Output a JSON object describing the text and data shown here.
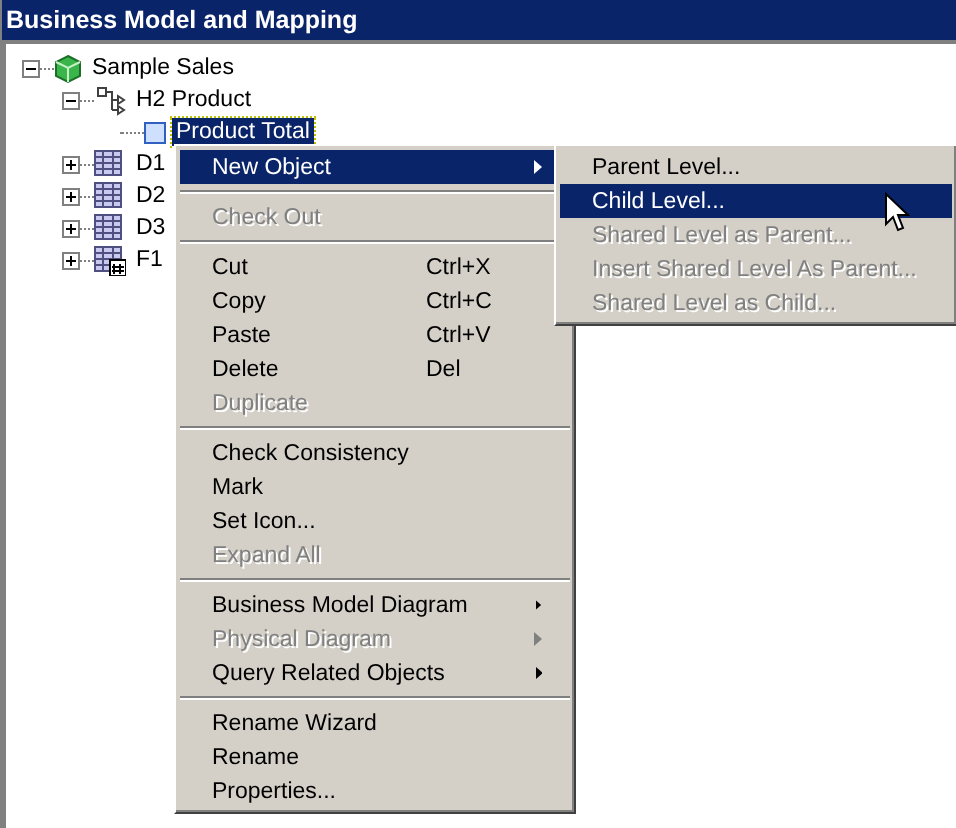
{
  "window": {
    "title": "Business Model and Mapping"
  },
  "tree": [
    {
      "label": "Sample Sales",
      "kind": "model",
      "expanded": true,
      "selected": false,
      "children": [
        {
          "label": "H2 Product",
          "kind": "hierarchy",
          "expanded": true,
          "selected": false,
          "children": [
            {
              "label": "Product Total",
              "kind": "level",
              "selected": true
            }
          ]
        },
        {
          "label": "D1",
          "kind": "table",
          "expanded": false,
          "selected": false
        },
        {
          "label": "D2",
          "kind": "table",
          "expanded": false,
          "selected": false
        },
        {
          "label": "D3",
          "kind": "table",
          "expanded": false,
          "selected": false
        },
        {
          "label": "F1",
          "kind": "fact",
          "expanded": false,
          "selected": false
        }
      ]
    }
  ],
  "context_menu": [
    {
      "kind": "item",
      "label": "New Object",
      "disabled": false,
      "submenu": true,
      "selected": true
    },
    {
      "kind": "separator"
    },
    {
      "kind": "item",
      "label": "Check Out",
      "disabled": true,
      "submenu": false,
      "selected": false
    },
    {
      "kind": "separator"
    },
    {
      "kind": "item",
      "label": "Cut",
      "shortcut": "Ctrl+X",
      "disabled": false,
      "submenu": false,
      "selected": false
    },
    {
      "kind": "item",
      "label": "Copy",
      "shortcut": "Ctrl+C",
      "disabled": false,
      "submenu": false,
      "selected": false
    },
    {
      "kind": "item",
      "label": "Paste",
      "shortcut": "Ctrl+V",
      "disabled": false,
      "submenu": false,
      "selected": false
    },
    {
      "kind": "item",
      "label": "Delete",
      "shortcut": "Del",
      "disabled": false,
      "submenu": false,
      "selected": false
    },
    {
      "kind": "item",
      "label": "Duplicate",
      "disabled": true,
      "submenu": false,
      "selected": false
    },
    {
      "kind": "separator"
    },
    {
      "kind": "item",
      "label": "Check Consistency",
      "disabled": false,
      "submenu": false,
      "selected": false
    },
    {
      "kind": "item",
      "label": "Mark",
      "disabled": false,
      "submenu": false,
      "selected": false
    },
    {
      "kind": "item",
      "label": "Set Icon...",
      "disabled": false,
      "submenu": false,
      "selected": false
    },
    {
      "kind": "item",
      "label": "Expand All",
      "disabled": true,
      "submenu": false,
      "selected": false
    },
    {
      "kind": "separator"
    },
    {
      "kind": "item",
      "label": "Business Model Diagram",
      "disabled": false,
      "submenu": true,
      "selected": false
    },
    {
      "kind": "item",
      "label": "Physical Diagram",
      "disabled": true,
      "submenu": true,
      "selected": false
    },
    {
      "kind": "item",
      "label": "Query Related Objects",
      "disabled": false,
      "submenu": true,
      "selected": false
    },
    {
      "kind": "separator"
    },
    {
      "kind": "item",
      "label": "Rename Wizard",
      "disabled": false,
      "submenu": false,
      "selected": false
    },
    {
      "kind": "item",
      "label": "Rename",
      "disabled": false,
      "submenu": false,
      "selected": false
    },
    {
      "kind": "item",
      "label": "Properties...",
      "disabled": false,
      "submenu": false,
      "selected": false
    }
  ],
  "submenu": [
    {
      "kind": "item",
      "label": "Parent Level...",
      "disabled": false,
      "selected": false
    },
    {
      "kind": "item",
      "label": "Child Level...",
      "disabled": false,
      "selected": true
    },
    {
      "kind": "item",
      "label": "Shared Level as Parent...",
      "disabled": true,
      "selected": false
    },
    {
      "kind": "item",
      "label": "Insert Shared Level As Parent...",
      "disabled": true,
      "selected": false
    },
    {
      "kind": "item",
      "label": "Shared Level as Child...",
      "disabled": true,
      "selected": false
    }
  ]
}
